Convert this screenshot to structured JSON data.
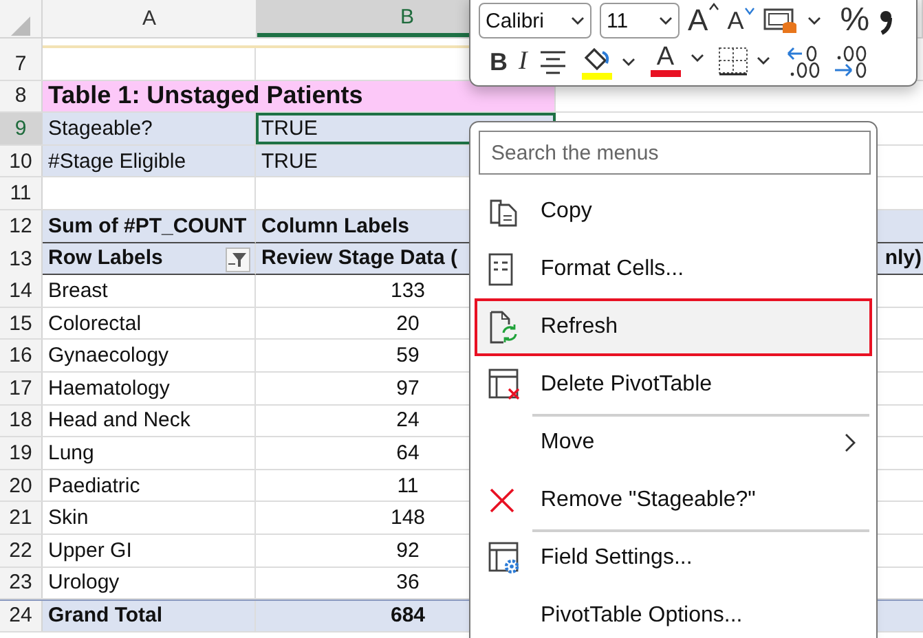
{
  "sheet": {
    "columns": [
      {
        "label": "A",
        "selected": false
      },
      {
        "label": "B",
        "selected": true
      }
    ],
    "rows": [
      {
        "row": "7",
        "kind": "blank",
        "selected": false,
        "cells": []
      },
      {
        "row": "8",
        "kind": "title",
        "selected": false,
        "cells": [
          "Table 1: Unstaged Patients"
        ]
      },
      {
        "row": "9",
        "kind": "filter",
        "selected": true,
        "cells": [
          "Stageable?",
          "TRUE"
        ]
      },
      {
        "row": "10",
        "kind": "filter",
        "selected": false,
        "cells": [
          "#Stage Eligible",
          "TRUE"
        ]
      },
      {
        "row": "11",
        "kind": "blank",
        "selected": false,
        "cells": []
      },
      {
        "row": "12",
        "kind": "pivot-header",
        "selected": false,
        "cells": [
          "Sum of #PT_COUNT",
          "Column Labels"
        ]
      },
      {
        "row": "13",
        "kind": "pivot-header",
        "selected": false,
        "filter_button": true,
        "cells": [
          "Row Labels",
          "Review Stage Data (",
          "nly)"
        ]
      },
      {
        "row": "14",
        "kind": "data",
        "selected": false,
        "cells": [
          "Breast",
          "133"
        ]
      },
      {
        "row": "15",
        "kind": "data",
        "selected": false,
        "cells": [
          "Colorectal",
          "20"
        ]
      },
      {
        "row": "16",
        "kind": "data",
        "selected": false,
        "cells": [
          "Gynaecology",
          "59"
        ]
      },
      {
        "row": "17",
        "kind": "data",
        "selected": false,
        "cells": [
          "Haematology",
          "97"
        ]
      },
      {
        "row": "18",
        "kind": "data",
        "selected": false,
        "cells": [
          "Head and Neck",
          "24"
        ]
      },
      {
        "row": "19",
        "kind": "data",
        "selected": false,
        "cells": [
          "Lung",
          "64"
        ]
      },
      {
        "row": "20",
        "kind": "data",
        "selected": false,
        "cells": [
          "Paediatric",
          "11"
        ]
      },
      {
        "row": "21",
        "kind": "data",
        "selected": false,
        "cells": [
          "Skin",
          "148"
        ]
      },
      {
        "row": "22",
        "kind": "data",
        "selected": false,
        "cells": [
          "Upper GI",
          "92"
        ]
      },
      {
        "row": "23",
        "kind": "data",
        "selected": false,
        "cells": [
          "Urology",
          "36"
        ]
      },
      {
        "row": "24",
        "kind": "total",
        "selected": false,
        "cells": [
          "Grand Total",
          "684"
        ]
      }
    ]
  },
  "mini_toolbar": {
    "font": "Calibri",
    "size": "11",
    "row_1": [
      {
        "kind": "grow-font",
        "label": "A"
      },
      {
        "kind": "shrink-font",
        "label": "A"
      },
      {
        "kind": "cell-styles"
      },
      {
        "kind": "text",
        "label": "%"
      },
      {
        "kind": "comma"
      }
    ],
    "row_2": [
      {
        "kind": "bold",
        "label": "B"
      },
      {
        "kind": "italic",
        "label": "I"
      },
      {
        "kind": "align"
      },
      {
        "kind": "fill-color"
      },
      {
        "kind": "font-color",
        "label": "A"
      },
      {
        "kind": "borders"
      },
      {
        "kind": "increase-decimal"
      },
      {
        "kind": "decrease-decimal"
      }
    ]
  },
  "menu": {
    "search": {
      "placeholder": "Search the menus"
    },
    "items": [
      {
        "label": "Copy",
        "kind": "copy",
        "selected": false,
        "divider_before": false,
        "submenu": false
      },
      {
        "label": "Format Cells...",
        "kind": "format",
        "selected": false,
        "divider_before": false,
        "submenu": false
      },
      {
        "label": "Refresh",
        "kind": "refresh",
        "selected": true,
        "divider_before": false,
        "submenu": false
      },
      {
        "label": "Delete PivotTable",
        "kind": "delete",
        "selected": false,
        "divider_before": false,
        "submenu": false
      },
      {
        "label": "Move",
        "kind": "plain",
        "selected": false,
        "divider_before": true,
        "submenu": true
      },
      {
        "label": "Remove \"Stageable?\"",
        "kind": "remove",
        "selected": false,
        "divider_before": false,
        "submenu": false
      },
      {
        "label": "Field Settings...",
        "kind": "settings",
        "selected": false,
        "divider_before": true,
        "submenu": false
      },
      {
        "label": "PivotTable Options...",
        "kind": "plain",
        "selected": false,
        "divider_before": false,
        "submenu": false
      }
    ]
  }
}
